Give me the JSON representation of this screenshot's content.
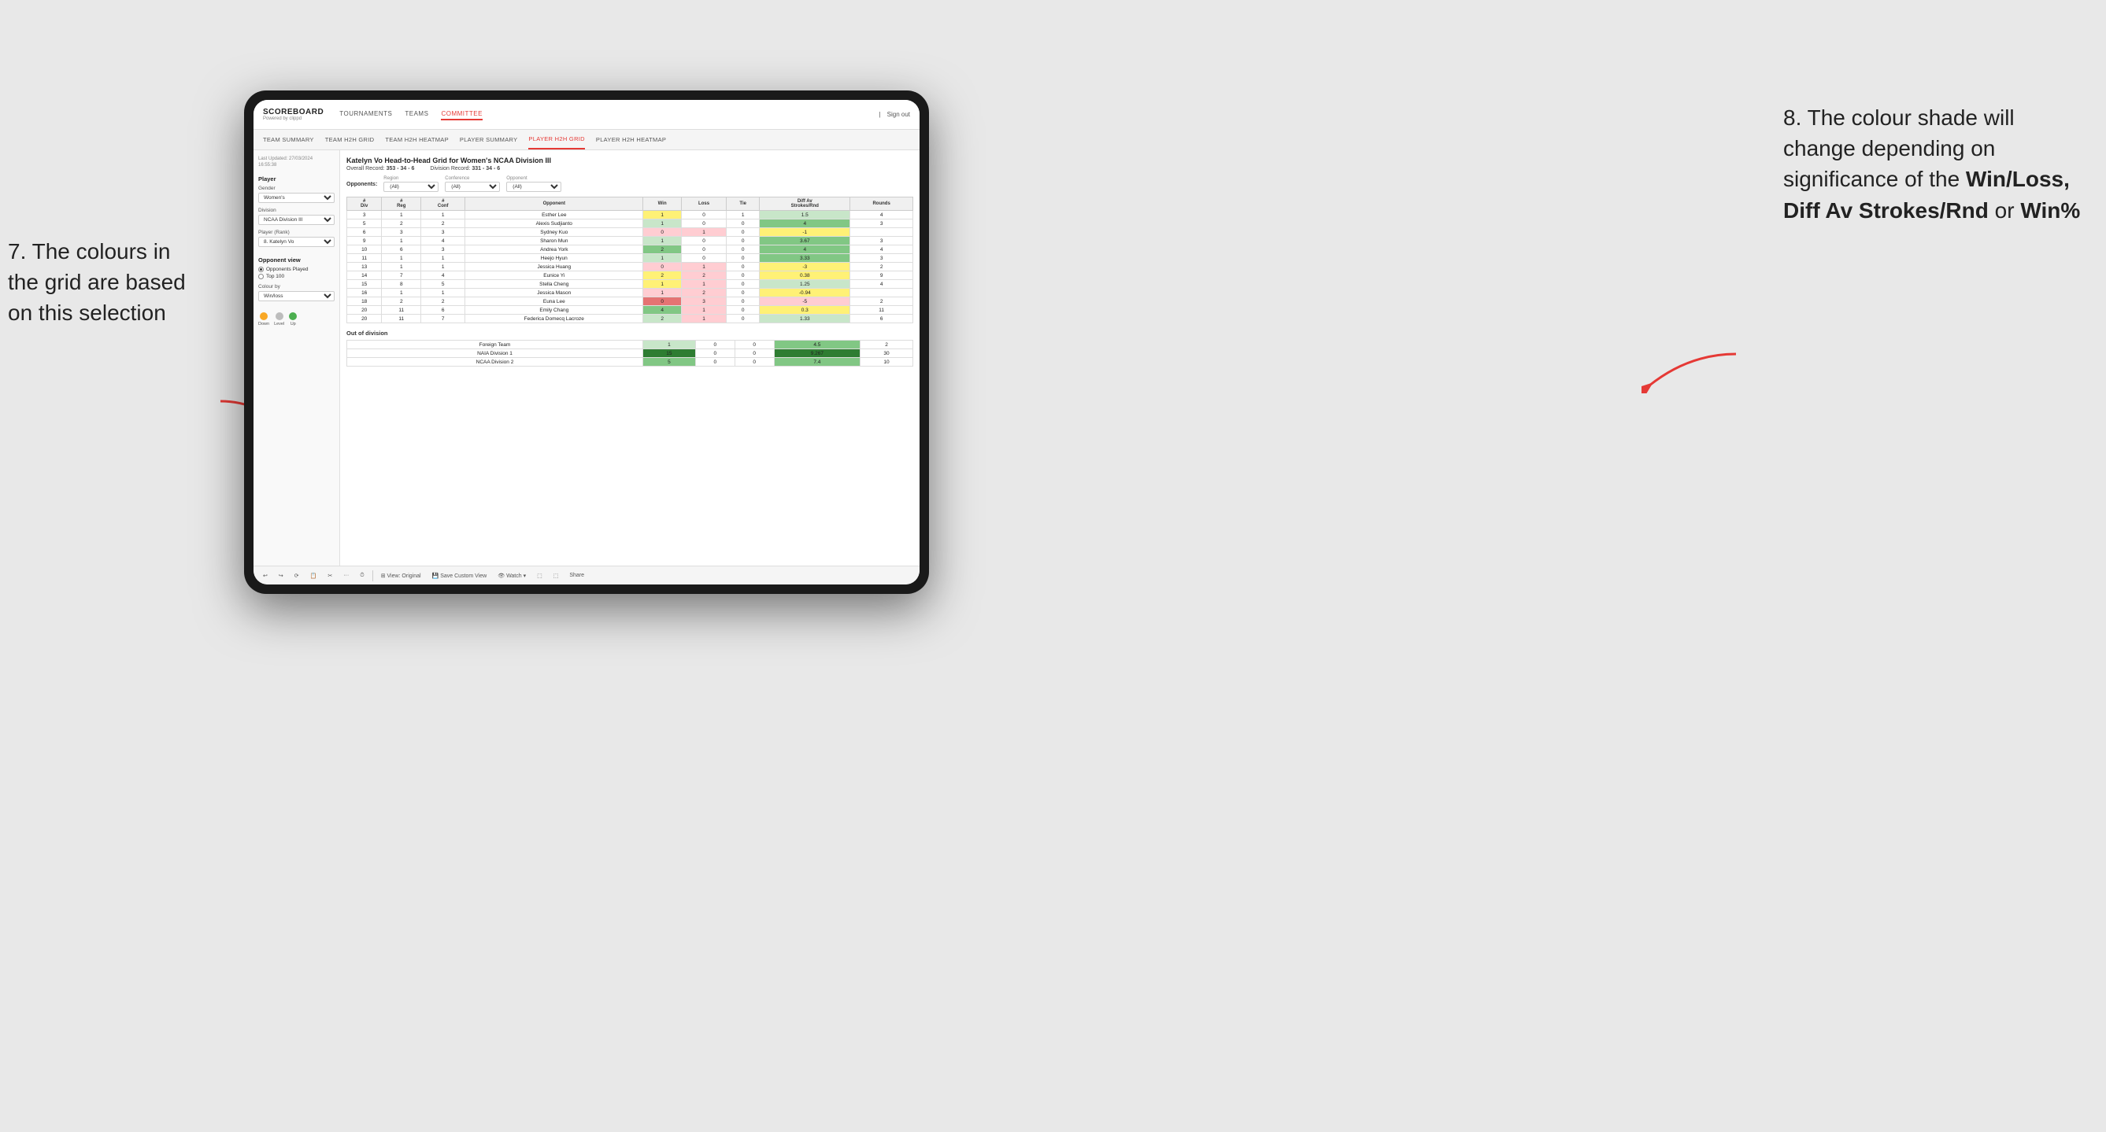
{
  "annotations": {
    "left": {
      "number": "7. The colours in\nthe grid are based\non this selection",
      "full": "7. The colours in the grid are based on this selection"
    },
    "right": {
      "number": "8. The colour shade will change depending on significance of the",
      "bold1": "Win/Loss, Diff Av Strokes/Rnd",
      "or": " or ",
      "bold2": "Win%"
    }
  },
  "nav": {
    "logo": "SCOREBOARD",
    "logo_sub": "Powered by clippd",
    "links": [
      "TOURNAMENTS",
      "TEAMS",
      "COMMITTEE"
    ],
    "active_link": "COMMITTEE",
    "right": [
      "Sign out"
    ]
  },
  "sub_nav": {
    "links": [
      "TEAM SUMMARY",
      "TEAM H2H GRID",
      "TEAM H2H HEATMAP",
      "PLAYER SUMMARY",
      "PLAYER H2H GRID",
      "PLAYER H2H HEATMAP"
    ],
    "active": "PLAYER H2H GRID"
  },
  "sidebar": {
    "last_updated_label": "Last Updated: 27/03/2024\n16:55:38",
    "player_section": "Player",
    "gender_label": "Gender",
    "gender_value": "Women's",
    "division_label": "Division",
    "division_value": "NCAA Division III",
    "player_rank_label": "Player (Rank)",
    "player_rank_value": "8. Katelyn Vo",
    "opponent_view_label": "Opponent view",
    "opponent_options": [
      "Opponents Played",
      "Top 100"
    ],
    "opponent_selected": "Opponents Played",
    "colour_by_label": "Colour by",
    "colour_by_value": "Win/loss",
    "legend": [
      {
        "label": "Down",
        "color": "#f9a825"
      },
      {
        "label": "Level",
        "color": "#bdbdbd"
      },
      {
        "label": "Up",
        "color": "#4caf50"
      }
    ]
  },
  "grid": {
    "title": "Katelyn Vo Head-to-Head Grid for Women's NCAA Division III",
    "overall_record_label": "Overall Record:",
    "overall_record": "353 - 34 - 6",
    "division_record_label": "Division Record:",
    "division_record": "331 - 34 - 6",
    "filters": {
      "opponents_label": "Opponents:",
      "region_label": "Region",
      "region_value": "(All)",
      "conference_label": "Conference",
      "conference_value": "(All)",
      "opponent_label": "Opponent",
      "opponent_value": "(All)"
    },
    "col_headers": [
      "#\nDiv",
      "#\nReg",
      "#\nConf",
      "Opponent",
      "Win",
      "Loss",
      "Tie",
      "Diff Av\nStrokes/Rnd",
      "Rounds"
    ],
    "rows": [
      {
        "div": 3,
        "reg": 1,
        "conf": 1,
        "opponent": "Esther Lee",
        "win": 1,
        "loss": 0,
        "tie": 1,
        "diff": 1.5,
        "rounds": 4,
        "win_color": "yellow",
        "diff_color": "green-light"
      },
      {
        "div": 5,
        "reg": 2,
        "conf": 2,
        "opponent": "Alexis Sudjianto",
        "win": 1,
        "loss": 0,
        "tie": 0,
        "diff": 4.0,
        "rounds": 3,
        "win_color": "green-light",
        "diff_color": "green"
      },
      {
        "div": 6,
        "reg": 3,
        "conf": 3,
        "opponent": "Sydney Kuo",
        "win": 0,
        "loss": 1,
        "tie": 0,
        "diff": -1.0,
        "rounds": "",
        "win_color": "red-light",
        "diff_color": "yellow"
      },
      {
        "div": 9,
        "reg": 1,
        "conf": 4,
        "opponent": "Sharon Mun",
        "win": 1,
        "loss": 0,
        "tie": 0,
        "diff": 3.67,
        "rounds": 3,
        "win_color": "green-light",
        "diff_color": "green"
      },
      {
        "div": 10,
        "reg": 6,
        "conf": 3,
        "opponent": "Andrea York",
        "win": 2,
        "loss": 0,
        "tie": 0,
        "diff": 4.0,
        "rounds": 4,
        "win_color": "green",
        "diff_color": "green"
      },
      {
        "div": 11,
        "reg": 1,
        "conf": 1,
        "opponent": "Heejo Hyun",
        "win": 1,
        "loss": 0,
        "tie": 0,
        "diff": 3.33,
        "rounds": 3,
        "win_color": "green-light",
        "diff_color": "green"
      },
      {
        "div": 13,
        "reg": 1,
        "conf": 1,
        "opponent": "Jessica Huang",
        "win": 0,
        "loss": 1,
        "tie": 0,
        "diff": -3.0,
        "rounds": 2,
        "win_color": "red-light",
        "diff_color": "yellow"
      },
      {
        "div": 14,
        "reg": 7,
        "conf": 4,
        "opponent": "Eunice Yi",
        "win": 2,
        "loss": 2,
        "tie": 0,
        "diff": 0.38,
        "rounds": 9,
        "win_color": "yellow",
        "diff_color": "yellow"
      },
      {
        "div": 15,
        "reg": 8,
        "conf": 5,
        "opponent": "Stella Cheng",
        "win": 1,
        "loss": 1,
        "tie": 0,
        "diff": 1.25,
        "rounds": 4,
        "win_color": "yellow",
        "diff_color": "green-light"
      },
      {
        "div": 16,
        "reg": 1,
        "conf": 1,
        "opponent": "Jessica Mason",
        "win": 1,
        "loss": 2,
        "tie": 0,
        "diff": -0.94,
        "rounds": "",
        "win_color": "red-light",
        "diff_color": "yellow"
      },
      {
        "div": 18,
        "reg": 2,
        "conf": 2,
        "opponent": "Euna Lee",
        "win": 0,
        "loss": 3,
        "tie": 0,
        "diff": -5.0,
        "rounds": 2,
        "win_color": "red",
        "diff_color": "red-light"
      },
      {
        "div": 20,
        "reg": 11,
        "conf": 6,
        "opponent": "Emily Chang",
        "win": 4,
        "loss": 1,
        "tie": 0,
        "diff": 0.3,
        "rounds": 11,
        "win_color": "green",
        "diff_color": "yellow"
      },
      {
        "div": 20,
        "reg": 11,
        "conf": 7,
        "opponent": "Federica Domecq Lacroze",
        "win": 2,
        "loss": 1,
        "tie": 0,
        "diff": 1.33,
        "rounds": 6,
        "win_color": "green-light",
        "diff_color": "green-light"
      }
    ],
    "out_of_division": {
      "title": "Out of division",
      "rows": [
        {
          "name": "Foreign Team",
          "win": 1,
          "loss": 0,
          "tie": 0,
          "diff": 4.5,
          "rounds": 2,
          "win_color": "green-light",
          "diff_color": "green"
        },
        {
          "name": "NAIA Division 1",
          "win": 15,
          "loss": 0,
          "tie": 0,
          "diff": 9.267,
          "rounds": 30,
          "win_color": "green-dark",
          "diff_color": "green-dark"
        },
        {
          "name": "NCAA Division 2",
          "win": 5,
          "loss": 0,
          "tie": 0,
          "diff": 7.4,
          "rounds": 10,
          "win_color": "green",
          "diff_color": "green"
        }
      ]
    }
  },
  "toolbar": {
    "buttons": [
      "↩",
      "↪",
      "⟳",
      "📋",
      "✂",
      "·",
      "⏱",
      "|",
      "View: Original",
      "Save Custom View",
      "Watch ▾",
      "⬚",
      "⬚",
      "Share"
    ]
  }
}
